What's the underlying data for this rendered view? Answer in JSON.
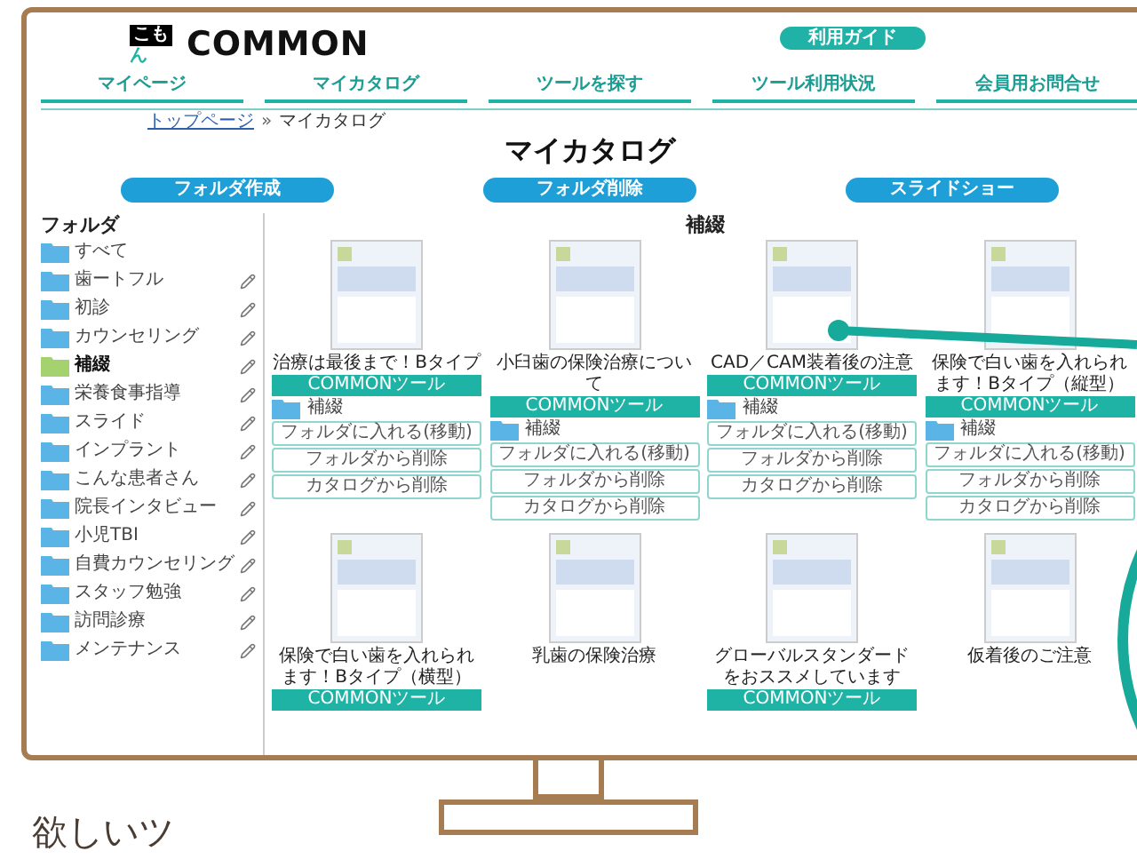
{
  "header": {
    "logo": {
      "mark_top": "こも",
      "mark_bottom": "ん",
      "name": "COMMON"
    },
    "guide_button": "利用ガイド"
  },
  "nav": [
    "マイページ",
    "マイカタログ",
    "ツールを探す",
    "ツール利用状況",
    "会員用お問合せ"
  ],
  "breadcrumb": {
    "link": "トップページ",
    "separator": "»",
    "current": "マイカタログ"
  },
  "page_title": "マイカタログ",
  "actions": [
    "フォルダ作成",
    "フォルダ削除",
    "スライドショー"
  ],
  "sidebar": {
    "title": "フォルダ",
    "items": [
      {
        "label": "すべて",
        "selected": false,
        "editable": false
      },
      {
        "label": "歯ートフル",
        "selected": false,
        "editable": true
      },
      {
        "label": "初診",
        "selected": false,
        "editable": true
      },
      {
        "label": "カウンセリング",
        "selected": false,
        "editable": true
      },
      {
        "label": "補綴",
        "selected": true,
        "editable": true
      },
      {
        "label": "栄養食事指導",
        "selected": false,
        "editable": true
      },
      {
        "label": "スライド",
        "selected": false,
        "editable": true
      },
      {
        "label": "インプラント",
        "selected": false,
        "editable": true
      },
      {
        "label": "こんな患者さん",
        "selected": false,
        "editable": true
      },
      {
        "label": "院長インタビュー",
        "selected": false,
        "editable": true
      },
      {
        "label": "小児TBI",
        "selected": false,
        "editable": true
      },
      {
        "label": "自費カウンセリング",
        "selected": false,
        "editable": true
      },
      {
        "label": "スタッフ勉強",
        "selected": false,
        "editable": true
      },
      {
        "label": "訪問診療",
        "selected": false,
        "editable": true
      },
      {
        "label": "メンテナンス",
        "selected": false,
        "editable": true
      }
    ]
  },
  "catalog": {
    "title": "補綴",
    "cards": [
      {
        "title": "治療は最後まで！Bタイプ",
        "tag": "COMMONツール",
        "folder": "補綴",
        "buttons": [
          "フォルダに入れる(移動)",
          "フォルダから削除",
          "カタログから削除"
        ]
      },
      {
        "title": "小臼歯の保険治療について",
        "tag": "COMMONツール",
        "folder": "補綴",
        "buttons": [
          "フォルダに入れる(移動)",
          "フォルダから削除",
          "カタログから削除"
        ]
      },
      {
        "title": "CAD／CAM装着後の注意",
        "tag": "COMMONツール",
        "folder": "補綴",
        "buttons": [
          "フォルダに入れる(移動)",
          "フォルダから削除",
          "カタログから削除"
        ]
      },
      {
        "title": "保険で白い歯を入れられます！Bタイプ（縦型）",
        "tag": "COMMONツール",
        "folder": "補綴",
        "buttons": [
          "フォルダに入れる(移動)",
          "フォルダから削除",
          "カタログから削除"
        ]
      },
      {
        "title": "保険で白い歯を入れられます！Bタイプ（横型）",
        "tag": "COMMONツール"
      },
      {
        "title": "乳歯の保険治療"
      },
      {
        "title": "グローバルスタンダードをおススメしています",
        "tag": "COMMONツール"
      },
      {
        "title": "仮着後のご注意"
      }
    ]
  },
  "caption": "欲しいツ"
}
